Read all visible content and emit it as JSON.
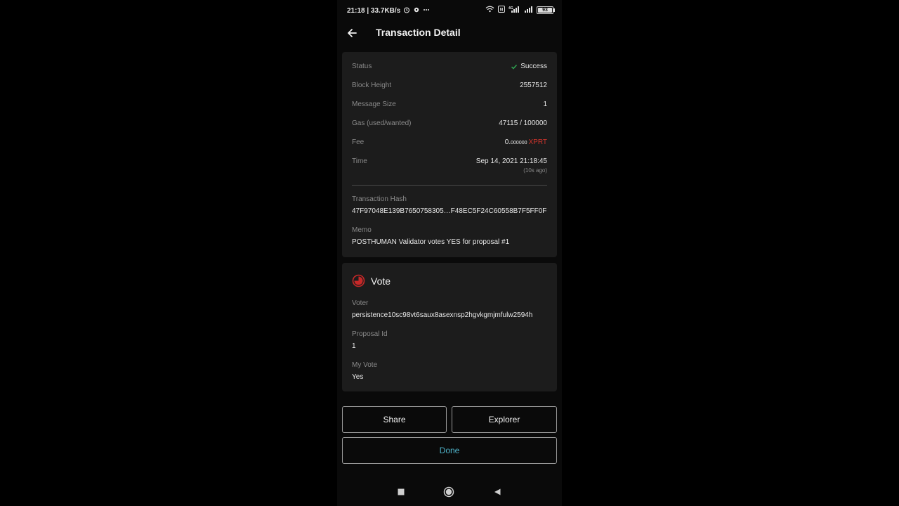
{
  "status_bar": {
    "time_speed": "21:18 | 33.7KB/s",
    "battery": "93"
  },
  "header": {
    "title": "Transaction Detail"
  },
  "summary": {
    "status_label": "Status",
    "status_value": "Success",
    "block_height_label": "Block Height",
    "block_height_value": "2557512",
    "message_size_label": "Message Size",
    "message_size_value": "1",
    "gas_label": "Gas (used/wanted)",
    "gas_value": "47115 / 100000",
    "fee_label": "Fee",
    "fee_int": "0.",
    "fee_decimals": "000000",
    "fee_denom": "XPRT",
    "time_label": "Time",
    "time_value": "Sep 14, 2021 21:18:45",
    "time_ago": "(10s ago)",
    "hash_label": "Transaction Hash",
    "hash_value": "47F97048E139B7650758305…F48EC5F24C60558B7F5FF0F",
    "memo_label": "Memo",
    "memo_value": "POSTHUMAN Validator votes YES for proposal #1"
  },
  "vote": {
    "title": "Vote",
    "voter_label": "Voter",
    "voter_value": "persistence10sc98vt6saux8asexnsp2hgvkgmjmfulw2594h",
    "proposal_label": "Proposal Id",
    "proposal_value": "1",
    "my_vote_label": "My Vote",
    "my_vote_value": "Yes"
  },
  "buttons": {
    "share": "Share",
    "explorer": "Explorer",
    "done": "Done"
  },
  "colors": {
    "success": "#2e9e4f",
    "fee_denom": "#d0342c",
    "done_text": "#4fb3c9",
    "vote_icon": "#c62828"
  },
  "icons": [
    "back-arrow-icon",
    "check-icon",
    "vote-icon",
    "wifi-icon",
    "alarm-icon",
    "settings-icon",
    "signal-icon",
    "battery-icon",
    "nav-square-icon",
    "nav-home-icon",
    "nav-back-icon"
  ]
}
